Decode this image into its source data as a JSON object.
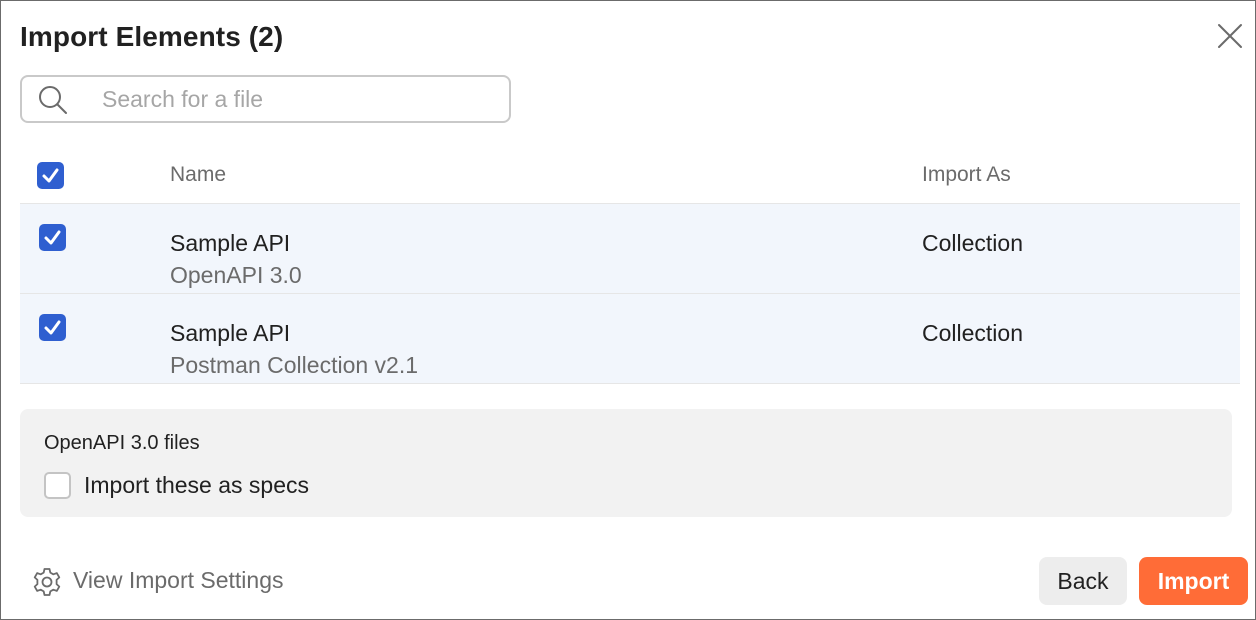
{
  "dialog": {
    "title": "Import Elements (2)",
    "close_icon": "close-icon"
  },
  "search": {
    "placeholder": "Search for a file",
    "icon": "search-icon"
  },
  "table": {
    "select_all_checked": true,
    "headers": {
      "name": "Name",
      "import_as": "Import As"
    },
    "rows": [
      {
        "checked": true,
        "name": "Sample API",
        "format": "OpenAPI 3.0",
        "import_as": "Collection"
      },
      {
        "checked": true,
        "name": "Sample API",
        "format": "Postman Collection v2.1",
        "import_as": "Collection"
      }
    ]
  },
  "options": {
    "title": "OpenAPI 3.0 files",
    "import_as_specs_label": "Import these as specs",
    "import_as_specs_checked": false
  },
  "footer": {
    "settings_label": "View Import Settings",
    "settings_icon": "gear-icon",
    "back_label": "Back",
    "import_label": "Import"
  },
  "colors": {
    "accent": "#ff6c37",
    "checkbox": "#2f5fd0",
    "row_highlight": "#f2f6fc"
  }
}
